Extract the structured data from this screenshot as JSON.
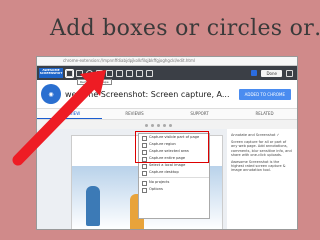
{
  "slide": {
    "title": "Add boxes or circles or…"
  },
  "browser": {
    "url": "chrome-extension://mpnnffdiabjdpjkolkfilqjbkffgjoghgckl/edit.html"
  },
  "toolbar": {
    "brand_line1": "AWESOME",
    "brand_line2": "SCREENSHOT",
    "tooltip": "Rectangle & Shape",
    "done_label": "Done"
  },
  "store": {
    "title": "wesome Screenshot: Screen capture, A...",
    "add_button": "ADDED TO CHROME",
    "tabs": [
      "OVERVIEW",
      "REVIEWS",
      "SUPPORT",
      "RELATED"
    ]
  },
  "menu": {
    "items": [
      "Capture visible part of page",
      "Capture region",
      "Capture selected area",
      "Capture entire page",
      "Select a local image",
      "Capture desktop",
      "Options"
    ],
    "extra": "No projects"
  },
  "sidebar": {
    "p1": "Annotate and Screenshot ✓",
    "p2": "Screen capture for all or part of any web page. Add annotations, comments, blur sensitive info, and share with one-click uploads.",
    "p3": "Awesome Screenshot is the highest rated screen capture & image annotation tool."
  },
  "colors": {
    "slide_bg": "#d08a8a",
    "toolbar_bg": "#3b3f46",
    "accent_blue": "#4a8cf0",
    "arrow_red": "#ee1c24"
  }
}
